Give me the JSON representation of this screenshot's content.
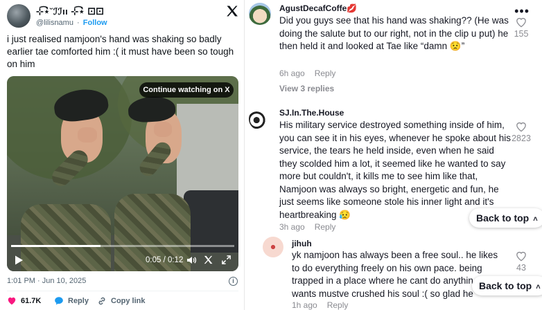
{
  "tweet": {
    "display_name": "⊹͡⋆̀˘ℐℐıı ⊹͡⋆̀ ⚀⚀",
    "handle": "@lilisnamu",
    "separator": "·",
    "follow_label": "Follow",
    "x_logo_icon": "x-logo-icon",
    "text": "i just realised namjoon's hand was shaking so badly earlier tae comforted him :( it must have been so tough on him",
    "media": {
      "continue_label": "Continue watching on X",
      "time": "0:05 / 0:12",
      "progress": 0.4
    },
    "timestamp": "1:01 PM · Jun 10, 2025",
    "info_icon": "i",
    "actions": {
      "likes": "61.7K",
      "reply_label": "Reply",
      "copy_label": "Copy link"
    },
    "colors": {
      "like": "#f91880",
      "reply": "#1d9bf0",
      "follow": "#1d9bf0"
    }
  },
  "comments": {
    "more_icon": "•••",
    "items": [
      {
        "user": "AgustDecafCoffe💋",
        "text": "Did you guys see that his hand was shaking?? (He was doing the salute but to our right, not in the clip u put) he then held it and looked at Tae like “damn 😟”",
        "time": "6h ago",
        "reply_label": "Reply",
        "likes": "155",
        "view_replies": "View 3 replies"
      },
      {
        "user": "SJ.In.The.House",
        "text": "His military service destroyed something inside of him, you can see it in his eyes, whenever he spoke about his service, the tears he held inside, even when he said they scolded him a lot, it seemed like he wanted to say more but couldn't, it kills me to see him like that, Namjoon was always so bright, energetic and fun, he just seems like someone stole his inner light and it's heartbreaking 😥",
        "time": "3h ago",
        "reply_label": "Reply",
        "likes": "2823"
      },
      {
        "user": "jihuh",
        "text": "yk namjoon has always been a free soul.. he likes to do everything freely on his own pace. being trapped in a place where he cant do anythin wants mustve crushed his soul :( so glad he",
        "time": "1h ago",
        "reply_label": "Reply",
        "likes": "43"
      }
    ],
    "back_to_top_label": "Back to top",
    "back_to_top_icon": "˄"
  }
}
